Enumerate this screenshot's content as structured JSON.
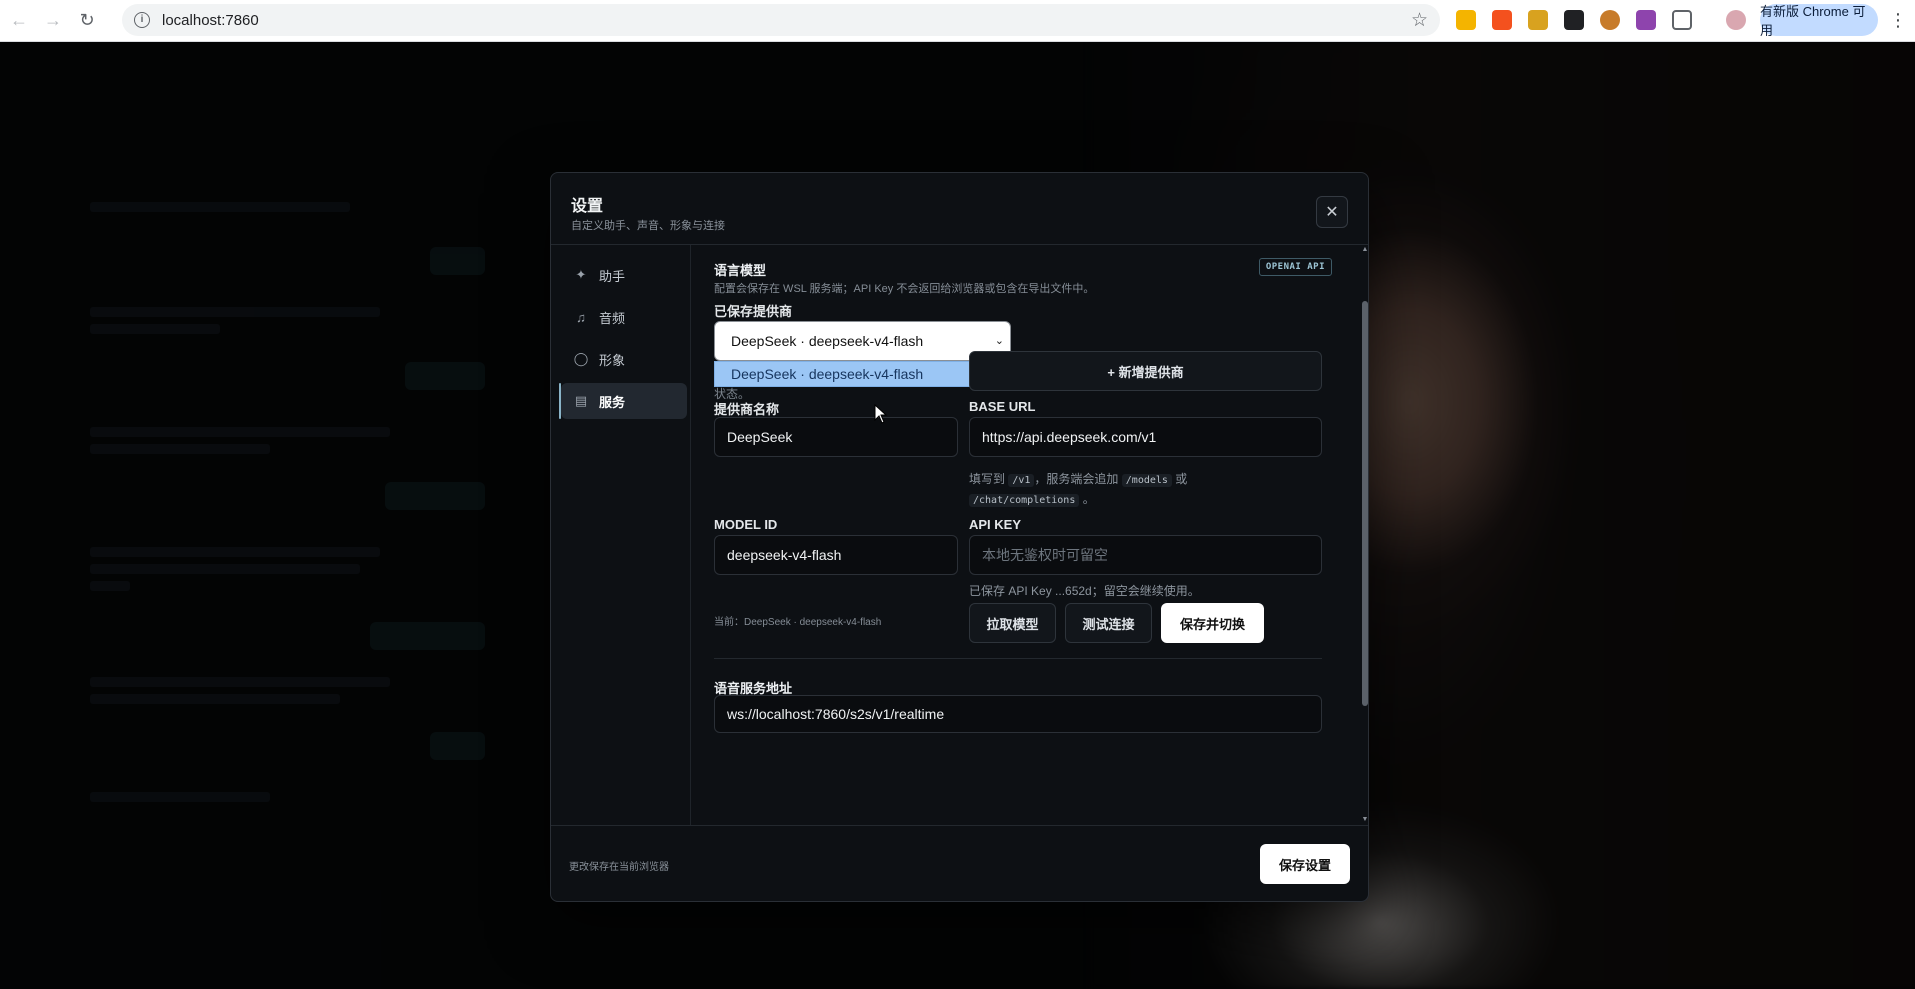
{
  "browser": {
    "url": "localhost:7860",
    "update_label": "有新版 Chrome 可用"
  },
  "modal": {
    "title": "设置",
    "subtitle": "自定义助手、声音、形象与连接",
    "footer_note": "更改保存在当前浏览器",
    "save_button": "保存设置"
  },
  "sidebar": {
    "items": [
      {
        "label": "助手",
        "icon": "sparkle-icon"
      },
      {
        "label": "音频",
        "icon": "speaker-icon"
      },
      {
        "label": "形象",
        "icon": "person-icon"
      },
      {
        "label": "服务",
        "icon": "server-icon",
        "active": true
      }
    ]
  },
  "llm": {
    "section_title": "语言模型",
    "badge": "OPENAI API",
    "description": "配置会保存在 WSL 服务端；API Key 不会返回给浏览器或包含在导出文件中。",
    "saved_provider_label": "已保存提供商",
    "saved_provider_value": "DeepSeek · deepseek-v4-flash",
    "dropdown_option": "DeepSeek · deepseek-v4-flash",
    "partial_hint": "状态。",
    "add_provider_button": "+ 新增提供商",
    "provider_name_label": "提供商名称",
    "provider_name_value": "DeepSeek",
    "base_url_label": "BASE URL",
    "base_url_value": "https://api.deepseek.com/v1",
    "base_url_hint_1": "填写到",
    "base_url_hint_code1": "/v1",
    "base_url_hint_2": "，服务端会追加",
    "base_url_hint_code2": "/models",
    "base_url_hint_3": "或",
    "base_url_hint_code3": "/chat/completions",
    "base_url_hint_4": "。",
    "model_id_label": "MODEL ID",
    "model_id_value": "deepseek-v4-flash",
    "api_key_label": "API KEY",
    "api_key_placeholder": "本地无鉴权时可留空",
    "api_key_hint": "已保存 API Key ...652d；留空会继续使用。",
    "current_label": "当前：DeepSeek · deepseek-v4-flash",
    "fetch_models_button": "拉取模型",
    "test_connection_button": "测试连接",
    "save_switch_button": "保存并切换"
  },
  "speech": {
    "section_title": "语音服务地址",
    "url_value": "ws://localhost:7860/s2s/v1/realtime"
  }
}
